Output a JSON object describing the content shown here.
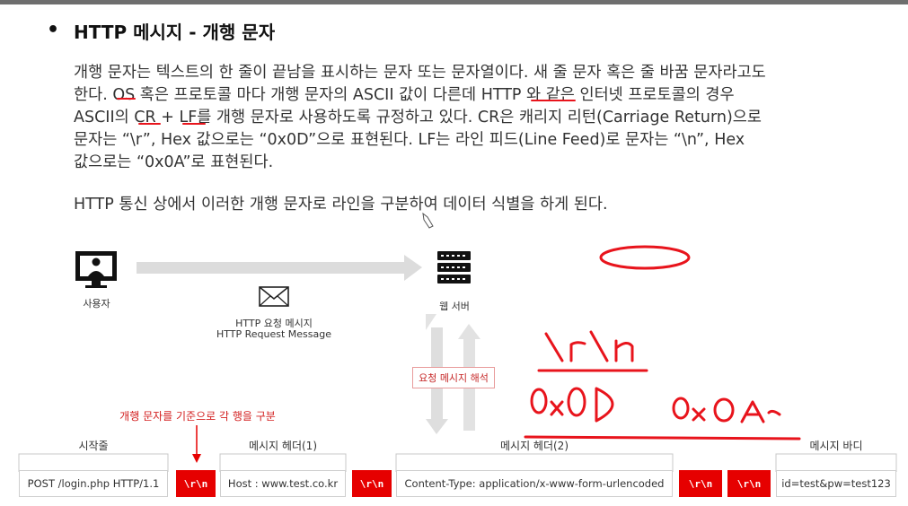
{
  "title": {
    "bullet": "•",
    "text": "HTTP 메시지 - 개행 문자"
  },
  "paragraph_lines": [
    "개행 문자는 텍스트의 한 줄이 끝남을 표시하는 문자 또는 문자열이다. 새 줄 문자 혹은 줄 바꿈 문자라고도",
    "한다. OS 혹은 프로토콜 마다 개행 문자의 ASCII 값이 다른데 HTTP 와 같은 인터넷 프로토콜의 경우",
    "ASCII의 CR + LF를 개행 문자로 사용하도록 규정하고 있다. CR은 캐리지 리턴(Carriage Return)으로",
    "문자는 “\\r”, Hex 값으로는 “0x0D”으로 표현된다. LF는 라인 피드(Line Feed)로 문자는 “\\n”, Hex",
    "값으로는 “0x0A”로 표현된다."
  ],
  "paragraph2": "HTTP 통신 상에서 이러한 개행 문자로 라인을 구분하여 데이터 식별을 하게 된다.",
  "diagram": {
    "user_label": "사용자",
    "server_label": "웹 서버",
    "message_label_ko": "HTTP 요청 메시지",
    "message_label_en": "HTTP Request Message",
    "parse_label": "요청 메시지 해석",
    "split_label": "개행 문자를 기준으로 각 행을 구분",
    "section_labels": {
      "start_line": "시작줄",
      "header1": "메시지 헤더(1)",
      "header2": "메시지 헤더(2)",
      "body": "메시지 바디"
    },
    "boxes": {
      "start_line": "POST /login.php HTTP/1.1",
      "header1": "Host : www.test.co.kr",
      "header2": "Content-Type: application/x-www-form-urlencoded",
      "body": "id=test&pw=test123"
    },
    "crlf_label": "\\r\\n"
  },
  "colors": {
    "accent_red": "#e60000",
    "annotation_red": "#e8141c",
    "arrow_gray": "#d9d9d9"
  },
  "icons": [
    "monitor-user-icon",
    "envelope-icon",
    "server-icon",
    "arrow-right-icon",
    "arrow-up-down-icon",
    "arrow-down-icon"
  ]
}
